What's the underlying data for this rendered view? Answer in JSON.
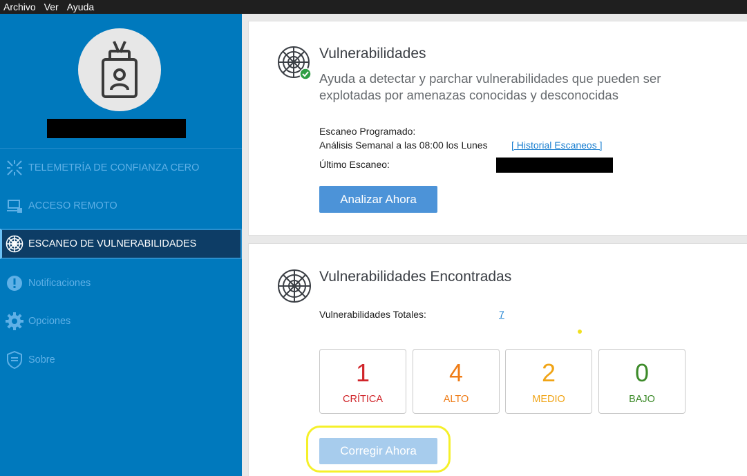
{
  "menubar": {
    "items": [
      "Archivo",
      "Ver",
      "Ayuda"
    ]
  },
  "sidebar": {
    "avatar_icon": "id-badge-icon",
    "items": [
      {
        "label": "TELEMETRÍA DE CONFIANZA CERO",
        "icon": "zero-trust-icon"
      },
      {
        "label": "ACCESO REMOTO",
        "icon": "remote-access-icon"
      },
      {
        "label": "ESCANEO DE VULNERABILIDADES",
        "icon": "radar-icon",
        "active": true
      },
      {
        "label": "Notificaciones",
        "icon": "alert-icon"
      },
      {
        "label": "Opciones",
        "icon": "gear-icon"
      },
      {
        "label": "Sobre",
        "icon": "shield-icon"
      }
    ]
  },
  "scan_card": {
    "title": "Vulnerabilidades",
    "description_line1": "Ayuda a detectar y parchar vulnerabilidades que pueden ser",
    "description_line2": "explotadas por amenazas conocidas y desconocidas",
    "scheduled_label": "Escaneo Programado:",
    "scheduled_value": "Análisis Semanal a las 08:00 los Lunes",
    "history_link": "[ Historial Escaneos ]",
    "last_scan_label": "Último Escaneo:",
    "analyze_button": "Analizar Ahora"
  },
  "found_card": {
    "title": "Vulnerabilidades Encontradas",
    "total_label": "Vulnerabilidades Totales:",
    "total_value": "7",
    "counts": [
      {
        "value": "1",
        "label": "CRÍTICA",
        "color": "#d0252a"
      },
      {
        "value": "4",
        "label": "ALTO",
        "color": "#ef7d18"
      },
      {
        "value": "2",
        "label": "MEDIO",
        "color": "#f0a416"
      },
      {
        "value": "0",
        "label": "BAJO",
        "color": "#3d8b2a"
      }
    ],
    "fix_button": "Corregir Ahora"
  },
  "colors": {
    "sidebar": "#0079bd",
    "sidebar_active": "#0d3d66",
    "button_primary": "#4c93d8",
    "button_disabled": "#a7cced",
    "highlight": "#f5f02a",
    "link": "#1b7fd0"
  }
}
